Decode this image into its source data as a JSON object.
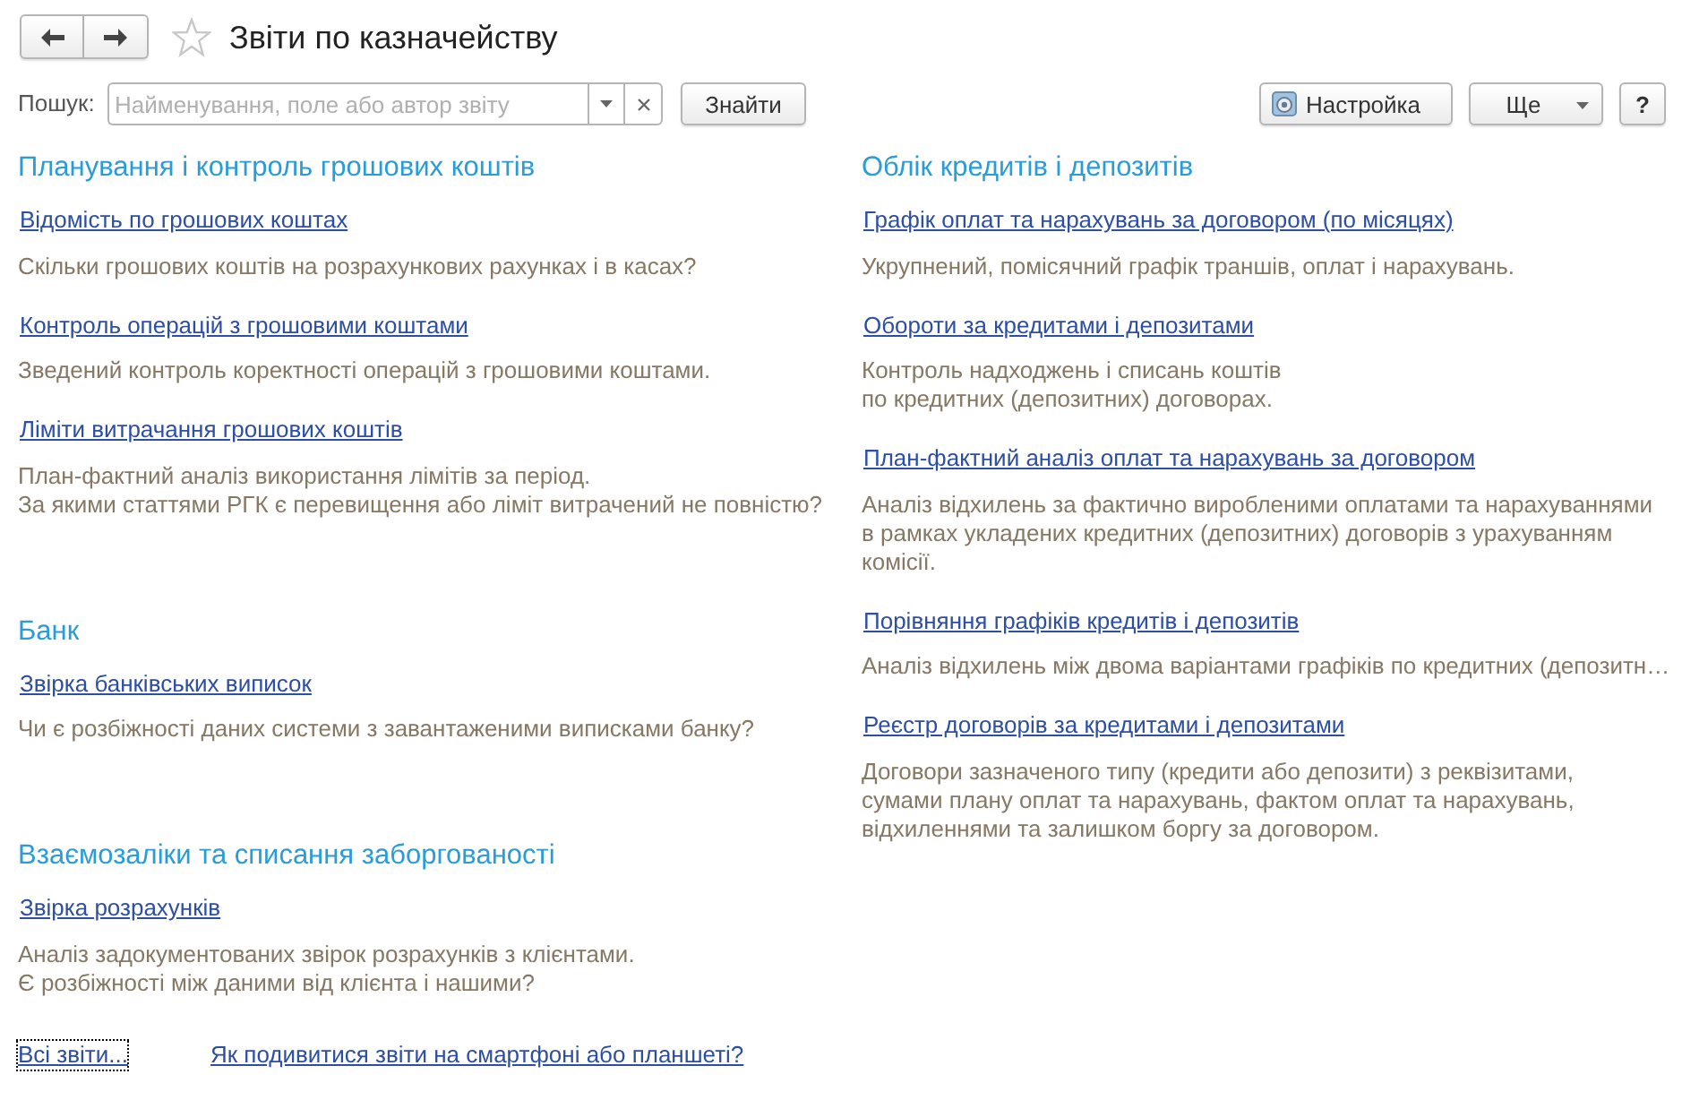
{
  "window": {
    "title": "Звіти по казначейству",
    "favorite": false
  },
  "search": {
    "label": "Пошук:",
    "placeholder": "Найменування, поле або автор звіту",
    "button": "Знайти"
  },
  "toolbar": {
    "settings": "Настройка",
    "more": "Ще",
    "help": "?"
  },
  "columns": [
    {
      "sections": [
        {
          "title": "Планування і контроль грошових коштів",
          "reports": [
            {
              "title": "Відомість по грошових коштах",
              "description": "Скільки грошових коштів на розрахункових рахунках і в касах?"
            },
            {
              "title": "Контроль операцій з грошовими коштами",
              "description": "Зведений контроль коректності операцій з грошовими коштами."
            },
            {
              "title": "Ліміти витрачання грошових коштів",
              "description": "План-фактний аналіз використання лімітів за період.\nЗа якими статтями РГК є перевищення або ліміт витрачений не повністю?"
            }
          ]
        },
        {
          "title": "Банк",
          "reports": [
            {
              "title": "Звірка банківських виписок",
              "description": "Чи є розбіжності даних системи з завантаженими виписками банку?"
            }
          ]
        },
        {
          "title": "Взаємозаліки та списання заборгованості",
          "reports": [
            {
              "title": "Звірка розрахунків",
              "description": "Аналіз задокументованих звірок розрахунків з клієнтами.\nЄ розбіжності між даними від клієнта і нашими?"
            }
          ]
        }
      ]
    },
    {
      "sections": [
        {
          "title": "Облік кредитів і депозитів",
          "reports": [
            {
              "title": "Графік оплат та нарахувань за договором (по місяцях)",
              "description": "Укрупнений, помісячний графік траншів, оплат і нарахувань."
            },
            {
              "title": "Обороти за кредитами і депозитами",
              "description": "Контроль надходжень і списань коштів\nпо кредитних (депозитних) договорах."
            },
            {
              "title": "План-фактний аналіз оплат та нарахувань за договором",
              "description": "Аналіз відхилень за фактично виробленими оплатами та нарахуваннями\nв рамках укладених кредитних (депозитних) договорів з урахуванням\nкомісії."
            },
            {
              "title": "Порівняння графіків кредитів і депозитів",
              "description": "Аналіз відхилень між двома варіантами графіків по кредитних (депозитн…"
            },
            {
              "title": "Реєстр договорів за кредитами і депозитами",
              "description": "Договори зазначеного типу (кредити або депозити) з реквізитами,\nсумами плану оплат та нарахувань, фактом оплат та нарахувань,\nвідхиленнями та залишком боргу за договором."
            }
          ]
        }
      ]
    }
  ],
  "footer": {
    "links": [
      {
        "text": "Всі звіти...",
        "focused": true
      },
      {
        "text": "Як подивитися звіти на смартфоні або планшеті?",
        "focused": false
      }
    ]
  }
}
